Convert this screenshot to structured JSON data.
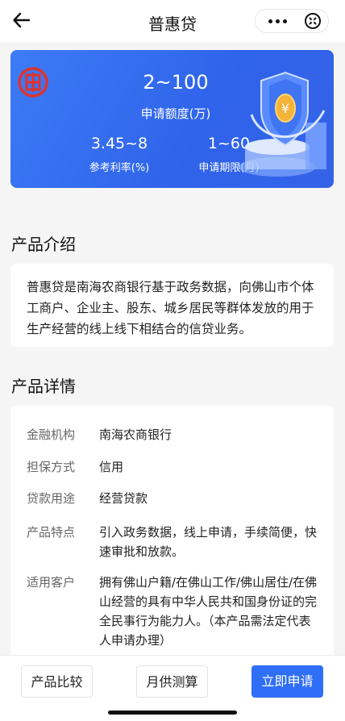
{
  "header": {
    "title": "普惠贷",
    "back_icon": "arrow-left-icon",
    "more_icon": "more-dots-icon",
    "close_icon": "close-circle-icon"
  },
  "hero": {
    "amount": "2~100",
    "amount_label": "申请额度(万)",
    "rate": "3.45~8",
    "rate_label": "参考利率(%)",
    "term": "1~60",
    "term_label": "申请期限(月)",
    "logo_icon": "bank-logo-icon",
    "colors": {
      "background": "#3566ea",
      "logo": "#e0322a"
    }
  },
  "intro": {
    "title": "产品介绍",
    "text": "普惠贷是南海农商银行基于政务数据，向佛山市个体工商户、企业主、股东、城乡居民等群体发放的用于生产经营的线上线下相结合的信贷业务。"
  },
  "details": {
    "title": "产品详情",
    "rows": [
      {
        "key": "金融机构",
        "value": "南海农商银行"
      },
      {
        "key": "担保方式",
        "value": "信用"
      },
      {
        "key": "贷款用途",
        "value": "经营贷款"
      },
      {
        "key": "产品特点",
        "value": "引入政务数据，线上申请，手续简便，快速审批和放款。"
      },
      {
        "key": "适用客户",
        "value": "拥有佛山户籍/在佛山工作/佛山居住/在佛山经营的具有中华人民共和国身份证的完全民事行为能力人。（本产品需法定代表人申请办理）"
      }
    ]
  },
  "actions": {
    "compare": "产品比较",
    "calc": "月供测算",
    "apply": "立即申请",
    "colors": {
      "primary": "#2f6ef6"
    }
  }
}
